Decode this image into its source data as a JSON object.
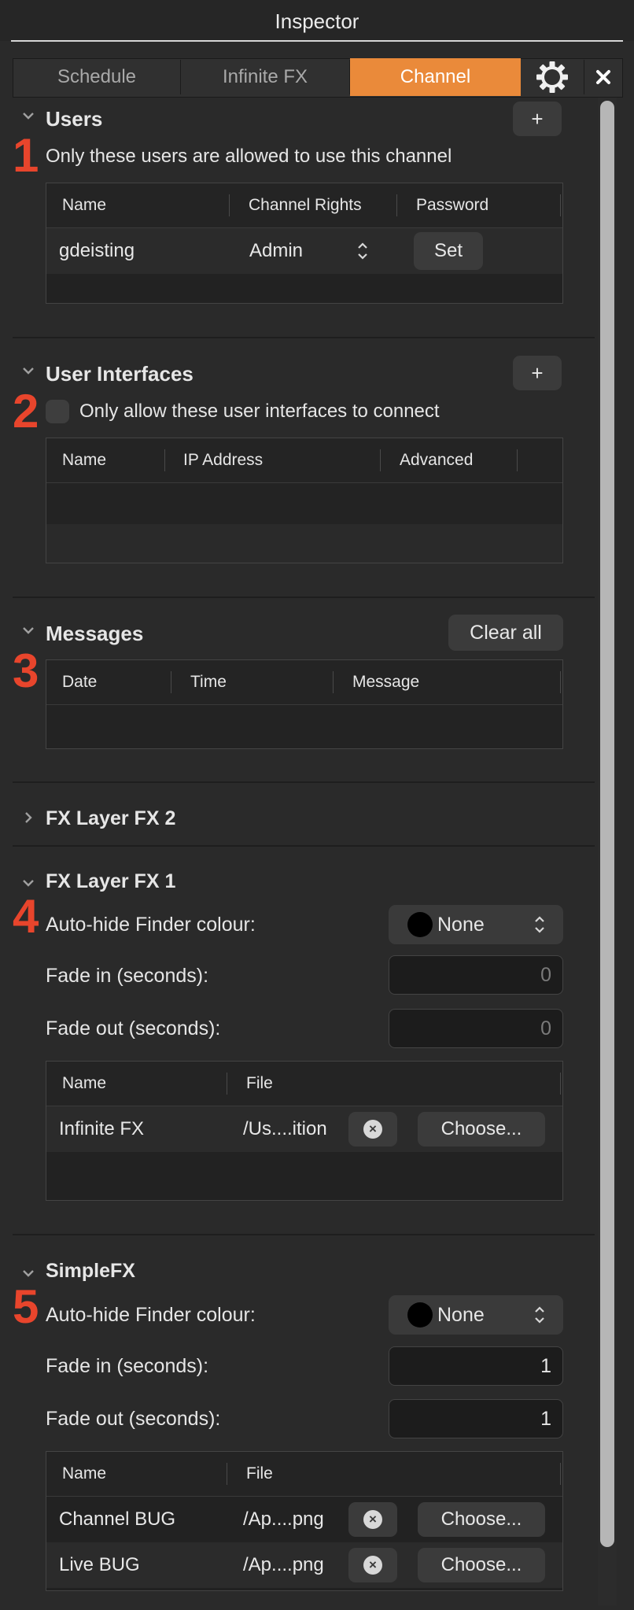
{
  "window": {
    "title": "Inspector"
  },
  "tabs": {
    "schedule": "Schedule",
    "infinite_fx": "Infinite FX",
    "channel": "Channel",
    "settings_icon": "gear-icon",
    "close_icon": "close-icon"
  },
  "colors": {
    "accent": "#ea8a3a",
    "annotation": "#e8452c"
  },
  "users": {
    "title": "Users",
    "number": "1",
    "add_label": "+",
    "description": "Only these users are allowed to use this channel",
    "columns": [
      "Name",
      "Channel Rights",
      "Password"
    ],
    "rows": [
      {
        "name": "gdeisting",
        "rights": "Admin",
        "password_button": "Set"
      }
    ]
  },
  "user_interfaces": {
    "title": "User Interfaces",
    "number": "2",
    "add_label": "+",
    "checkbox_label": "Only allow these user interfaces to connect",
    "checked": false,
    "columns": [
      "Name",
      "IP Address",
      "Advanced"
    ]
  },
  "messages": {
    "title": "Messages",
    "number": "3",
    "clear_label": "Clear all",
    "columns": [
      "Date",
      "Time",
      "Message"
    ]
  },
  "fx_layer_2": {
    "title": "FX Layer FX 2",
    "expanded": false
  },
  "fx_layer_1": {
    "title": "FX Layer FX 1",
    "number": "4",
    "autohide_label": "Auto-hide Finder colour:",
    "autohide_value": "None",
    "fade_in_label": "Fade in (seconds):",
    "fade_in_value": "0",
    "fade_out_label": "Fade out (seconds):",
    "fade_out_value": "0",
    "columns": [
      "Name",
      "File"
    ],
    "rows": [
      {
        "name": "Infinite FX",
        "file": "/Us....ition",
        "choose": "Choose..."
      }
    ]
  },
  "simplefx": {
    "title": "SimpleFX",
    "number": "5",
    "autohide_label": "Auto-hide Finder colour:",
    "autohide_value": "None",
    "fade_in_label": "Fade in (seconds):",
    "fade_in_value": "1",
    "fade_out_label": "Fade out (seconds):",
    "fade_out_value": "1",
    "columns": [
      "Name",
      "File"
    ],
    "rows": [
      {
        "name": "Channel BUG",
        "file": "/Ap....png",
        "choose": "Choose..."
      },
      {
        "name": "Live BUG",
        "file": "/Ap....png",
        "choose": "Choose..."
      }
    ]
  }
}
